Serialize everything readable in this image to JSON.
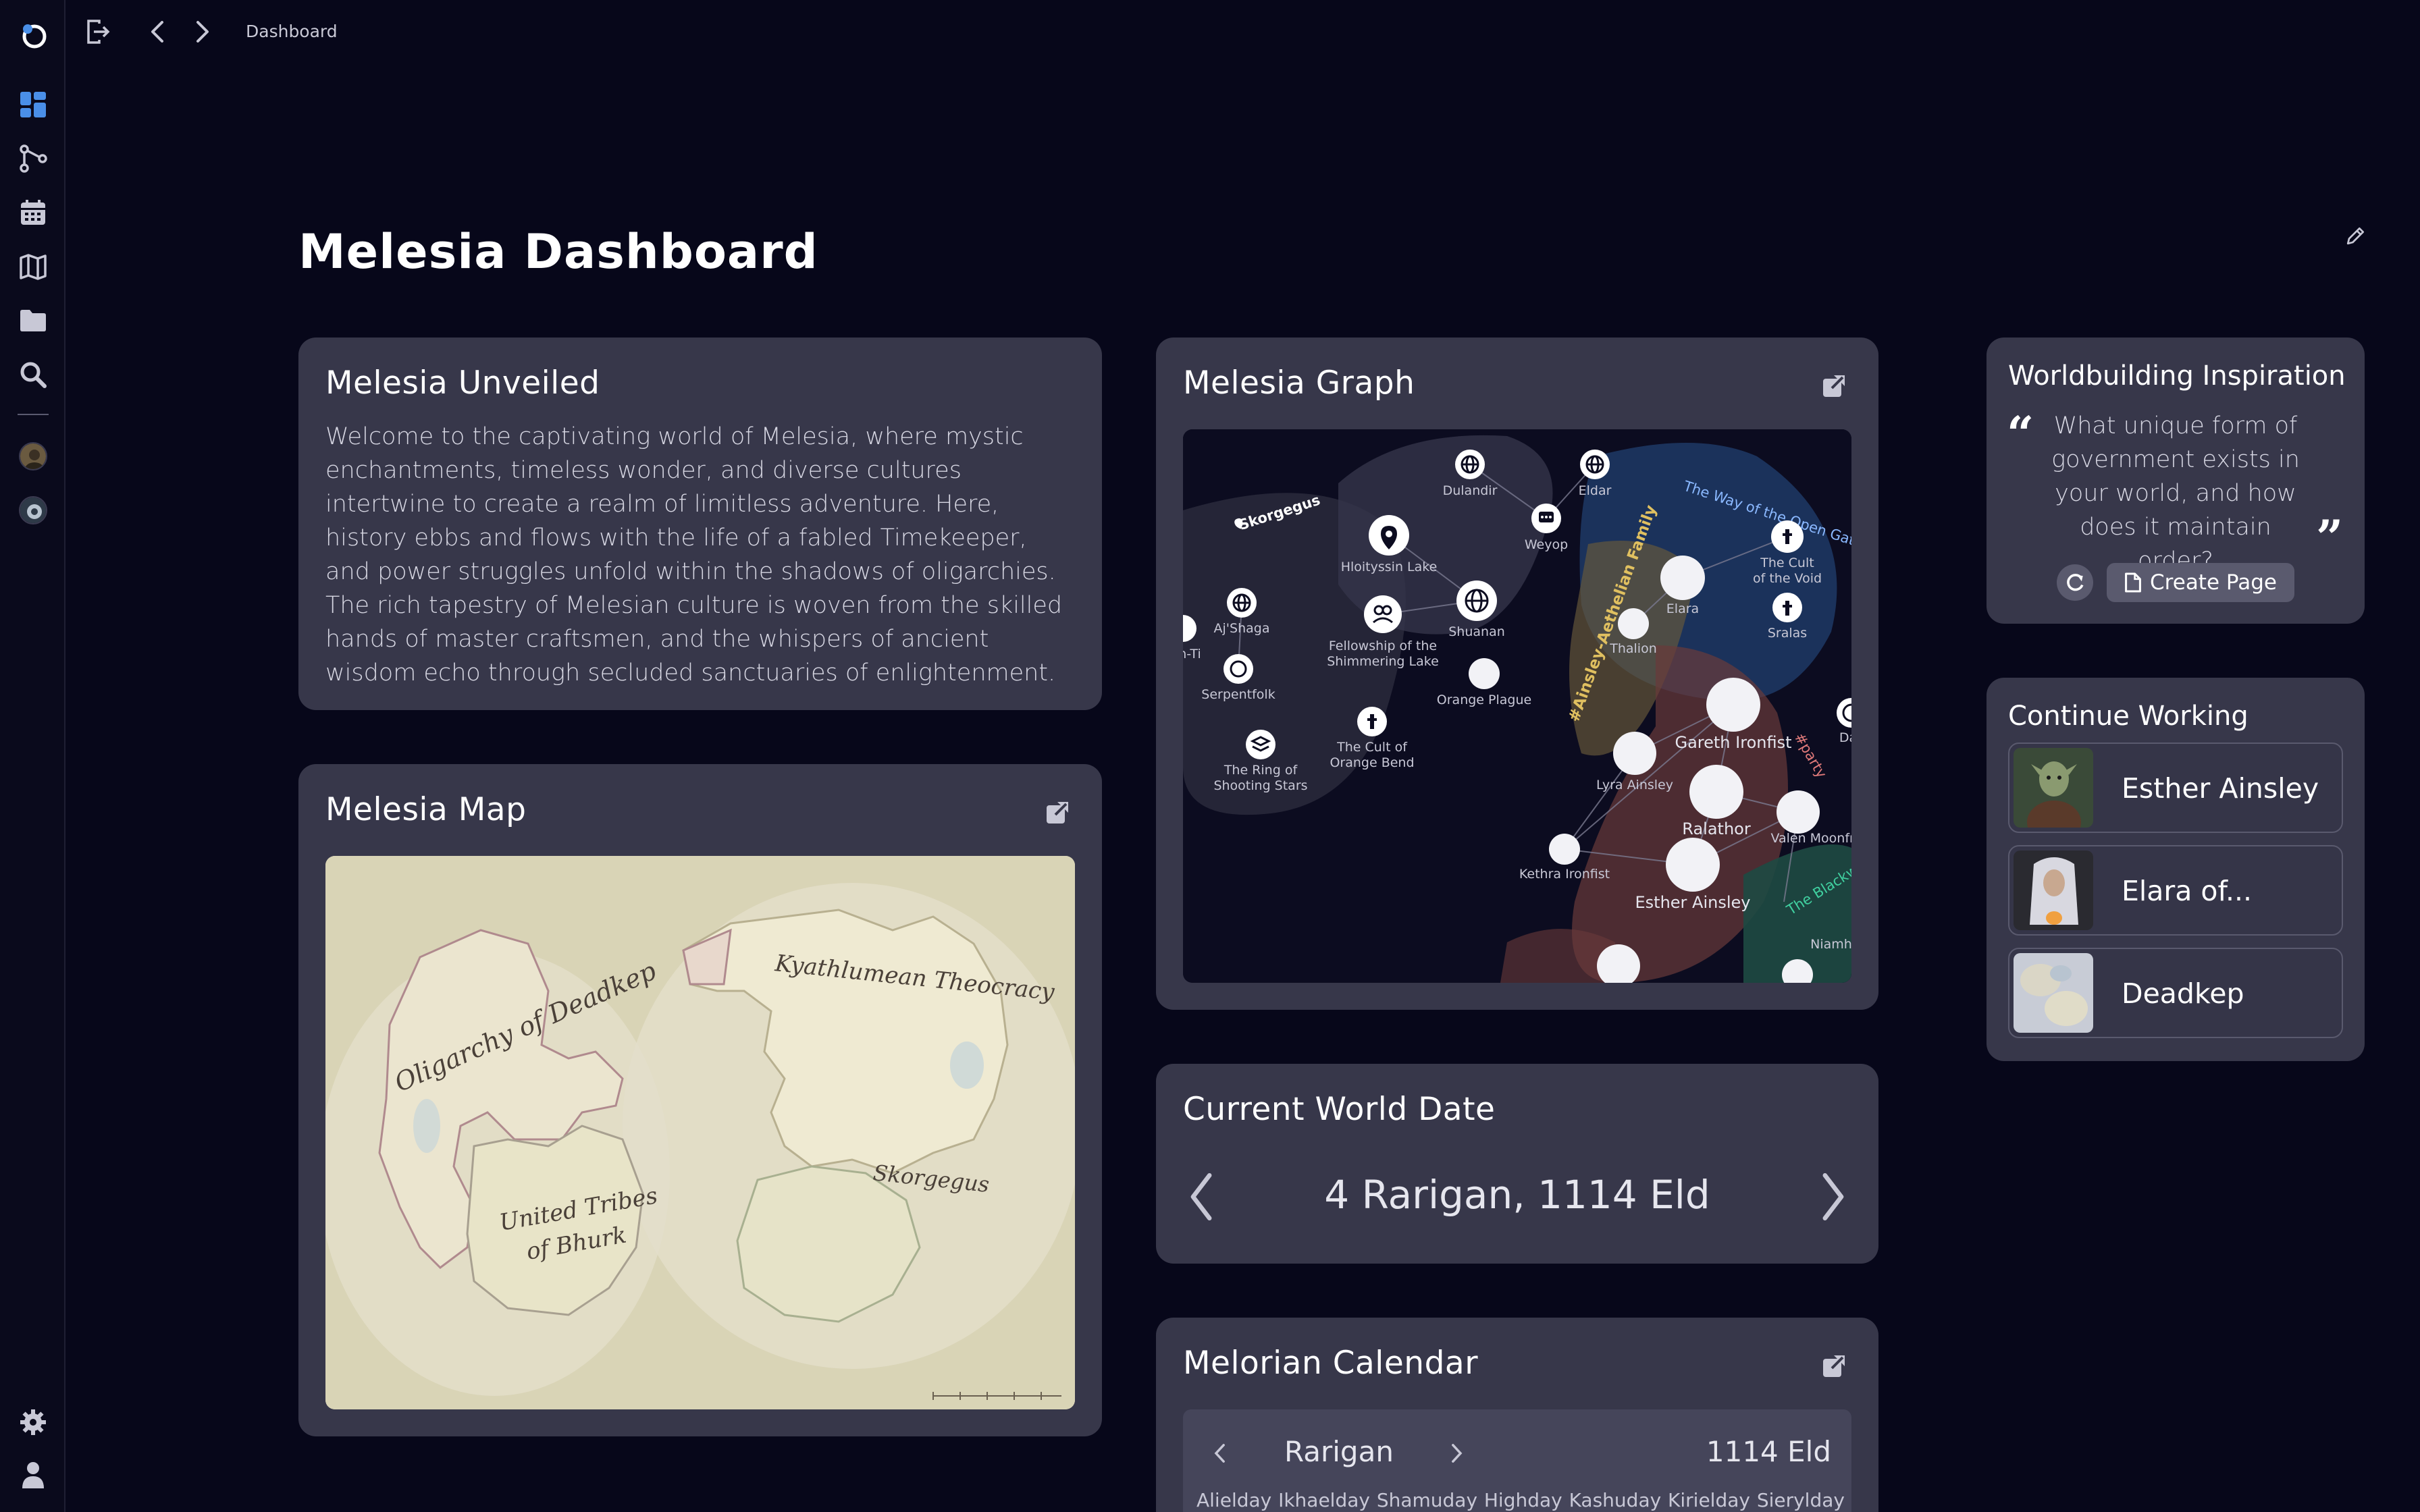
{
  "breadcrumb": "Dashboard",
  "page_title": "Melesia Dashboard",
  "sidebar": {
    "items": [
      {
        "name": "dashboard-icon",
        "active": true
      },
      {
        "name": "graph-icon"
      },
      {
        "name": "calendar-icon"
      },
      {
        "name": "map-icon"
      },
      {
        "name": "folder-icon"
      },
      {
        "name": "search-icon"
      }
    ],
    "bottom": [
      "settings-icon",
      "user-icon"
    ]
  },
  "unveiled": {
    "title": "Melesia Unveiled",
    "body": "Welcome to the captivating world of Melesia, where mystic enchantments, timeless wonder, and diverse cultures intertwine to create a realm of limitless adventure. Here, history ebbs and flows with the life of a fabled Timekeeper, and power struggles unfold within the shadows of oligarchies. The rich tapestry of Melesian culture is woven from the skilled hands of master craftsmen, and the whispers of ancient wisdom echo through secluded sanctuaries of enlightenment."
  },
  "map": {
    "title": "Melesia Map",
    "labels": {
      "deadkep": "Oligarchy of Deadkep",
      "kyathlumean": "Kyathlumean Theocracy",
      "bhurk_1": "United Tribes",
      "bhurk_2": "of Bhurk",
      "skorgegus": "Skorgegus"
    }
  },
  "graph": {
    "title": "Melesia Graph",
    "nodes": {
      "skorgegus": "Skorgegus",
      "dulandir": "Dulandir",
      "eldar": "Eldar",
      "weyop": "Weyop",
      "hloityssin": "Hloityssin Lake",
      "ajshaga": "Aj'Shaga",
      "nti": "n-Ti",
      "serpentfolk": "Serpentfolk",
      "fellowship_1": "Fellowship of the",
      "fellowship_2": "Shimmering Lake",
      "shuanan": "Shuanan",
      "orange_plague": "Orange Plague",
      "ring_1": "The Ring of",
      "ring_2": "Shooting Stars",
      "cult_orange_1": "The Cult of",
      "cult_orange_2": "Orange Bend",
      "elara": "Elara",
      "thalion": "Thalion",
      "cult_void_1": "The Cult",
      "cult_void_2": "of the Void",
      "sralas": "Sralas",
      "gareth": "Gareth Ironfist",
      "lyra": "Lyra Ainsley",
      "ralathor": "Ralathor",
      "valen": "Valen Moonfront",
      "kethra": "Kethra Ironfist",
      "esther": "Esther Ainsley",
      "niamh": "Niamh",
      "da": "Da",
      "open_gate": "The Way of the Open Gate",
      "family": "#Ainsley-Aethelian Family",
      "party": "#party",
      "blackw": "The Blackw"
    }
  },
  "date": {
    "title": "Current World Date",
    "value": "4 Rarigan, 1114 Eld"
  },
  "calendar": {
    "title": "Melorian Calendar",
    "month": "Rarigan",
    "year": "1114 Eld",
    "days": [
      "Alielday",
      "Ikhaelday",
      "Shamuday",
      "Highday",
      "Kashuday",
      "Kirielday",
      "Sierylday"
    ]
  },
  "inspiration": {
    "title": "Worldbuilding Inspiration",
    "prompt": "What unique form of government exists in your world, and how does it maintain order?",
    "create_label": "Create Page"
  },
  "continue": {
    "title": "Continue Working",
    "items": [
      {
        "label": "Esther Ainsley"
      },
      {
        "label": "Elara of..."
      },
      {
        "label": "Deadkep"
      }
    ]
  },
  "colors": {
    "background": "#07071a",
    "card": "#37374a",
    "accent": "#4a8fe8"
  }
}
